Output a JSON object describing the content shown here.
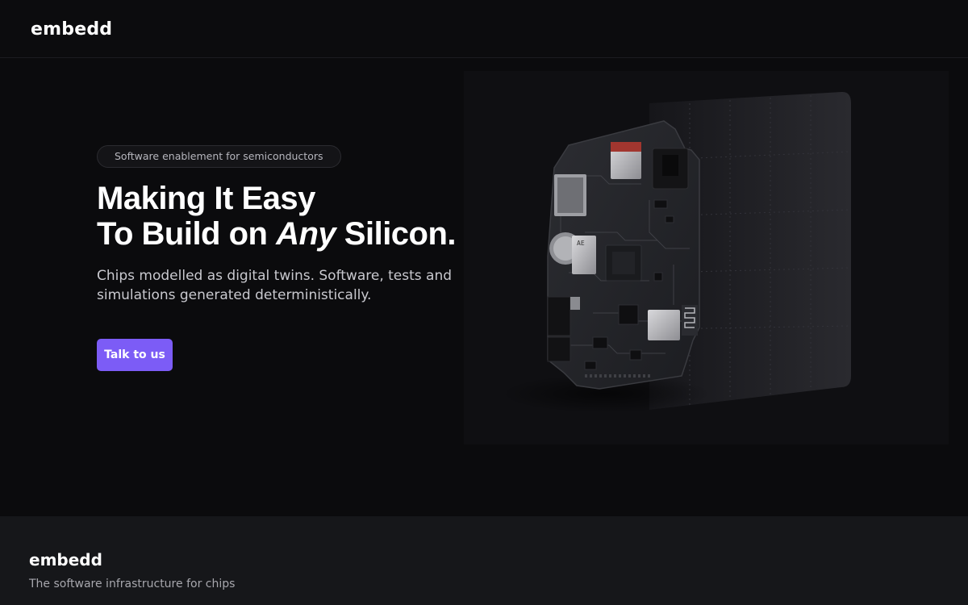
{
  "header": {
    "logo_text": "embedd"
  },
  "hero": {
    "badge": "Software enablement for semiconductors",
    "headline_line1": "Making It Easy",
    "headline_line2_prefix": "To Build on ",
    "headline_line2_emphasis": "Any",
    "headline_line2_suffix": " Silicon.",
    "description": "Chips modelled as digital twins. Software, tests and simulations generated deterministically.",
    "cta_label": "Talk to us",
    "image_chip_label": "AE"
  },
  "footer": {
    "logo_text": "embedd",
    "tagline": "The software infrastructure for chips"
  },
  "colors": {
    "background": "#0b0b0d",
    "accent": "#7c5cf6",
    "footer_background": "#16171a",
    "text_primary": "#ffffff",
    "text_secondary": "#c9c9cf"
  }
}
